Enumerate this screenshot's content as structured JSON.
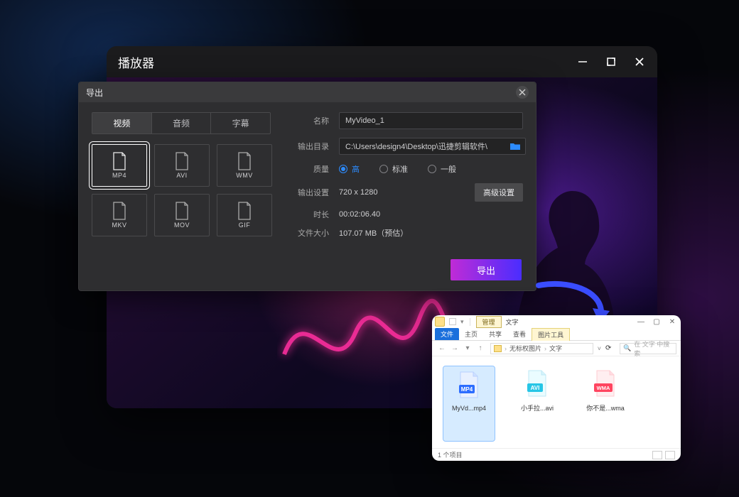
{
  "player": {
    "title": "播放器"
  },
  "export": {
    "title": "导出",
    "tabs": {
      "video": "视频",
      "audio": "音频",
      "subtitle": "字幕"
    },
    "formats": {
      "mp4": "MP4",
      "avi": "AVI",
      "wmv": "WMV",
      "mkv": "MKV",
      "mov": "MOV",
      "gif": "GIF"
    },
    "labels": {
      "name": "名称",
      "outdir": "输出目录",
      "quality": "质量",
      "outset": "输出设置",
      "duration": "时长",
      "filesize": "文件大小"
    },
    "name_value": "MyVideo_1",
    "outdir_value": "C:\\Users\\design4\\Desktop\\迅捷剪辑软件\\",
    "quality": {
      "high": "高",
      "standard": "标准",
      "normal": "一般"
    },
    "outset_value": "720 x 1280",
    "advanced_btn": "高级设置",
    "duration_value": "00:02:06.40",
    "filesize_value": "107.07 MB（预估）",
    "export_btn": "导出"
  },
  "explorer": {
    "manage_tab": "管理",
    "title_text": "文字",
    "ribbon": {
      "file": "文件",
      "home": "主页",
      "share": "共享",
      "view": "查看",
      "pic_tools": "图片工具"
    },
    "breadcrumb": {
      "p1": "无标权图片",
      "p2": "文字"
    },
    "search_placeholder": "在 文字 中搜索",
    "files": {
      "f1": {
        "badge": "MP4",
        "name": "MyVd...mp4"
      },
      "f2": {
        "badge": "AVI",
        "name": "小手拉...avi"
      },
      "f3": {
        "badge": "WMA",
        "name": "你不是...wma"
      }
    },
    "status": "1 个项目"
  }
}
